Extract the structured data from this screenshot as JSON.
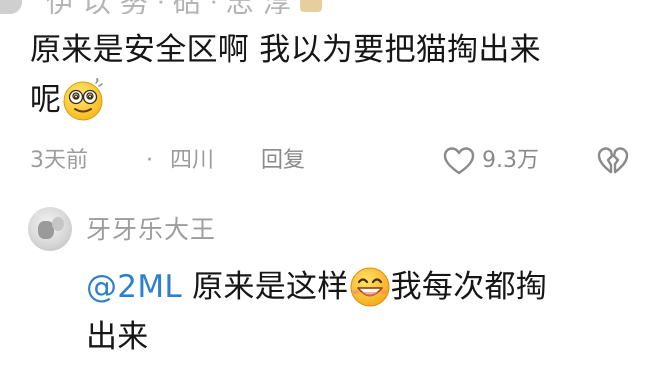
{
  "previous_comment_partial": {
    "name_fragment": "伊 以 努 ᐧ 砧 ᐧ 忠 淳"
  },
  "comment": {
    "text_line1": "原来是安全区啊 我以为要把猫掏出来",
    "text_line2": "呢",
    "emoji": "dizzy-face-emoji",
    "time": "3天前",
    "separator": "·",
    "location": "四川",
    "reply_label": "回复",
    "like_count": "9.3万"
  },
  "reply": {
    "author": "牙牙乐大王",
    "mention": "@2ML",
    "text_part1": " 原来是这样",
    "emoji": "grinning-sweat-emoji",
    "text_part2": "我每次都掏",
    "text_line2": "出来"
  },
  "colors": {
    "primary_text": "#161616",
    "meta_text": "#9c9c9c",
    "mention": "#2f7fd0",
    "background": "#ffffff"
  }
}
